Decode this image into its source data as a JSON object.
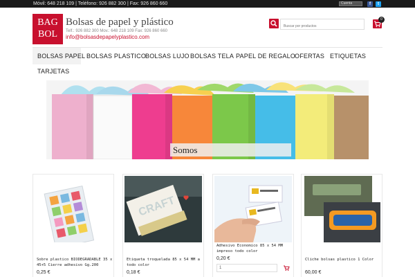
{
  "topbar": {
    "contact": "Móvil: 648 218 109 | Teléfono: 926 882 300 | Fax: 926 860 660",
    "account_label": "Cuenta",
    "facebook": "f",
    "twitter": "t"
  },
  "brand": {
    "logo_line1": "BAG",
    "logo_line2": "BOL",
    "title": "Bolsas de papel y plástico",
    "phones": "Telf.: 926 882 300   Mov.: 648 218 109   Fax: 926 860 660",
    "email": "info@bolsasdepapelyplastico.com",
    "accent": "#c8102e"
  },
  "search": {
    "placeholder": "Buscar por productos",
    "icon": "search-icon"
  },
  "cart": {
    "count": "0",
    "icon": "cart-icon"
  },
  "nav": {
    "items": [
      {
        "label": "BOLSAS PAPEL"
      },
      {
        "label": "BOLSAS PLASTICO"
      },
      {
        "label": "BOLSAS LUJO"
      },
      {
        "label": "BOLSAS TELA"
      },
      {
        "label": "PAPEL DE REGALO"
      },
      {
        "label": "OFERTAS"
      },
      {
        "label": "ETIQUETAS"
      },
      {
        "label": "TARJETAS"
      }
    ]
  },
  "banner": {
    "caption": "Somos"
  },
  "products": [
    {
      "name": "Sobre plastico BIODEGRADABLE 35 x 45+5 Cierre adhesivo Gg.200",
      "price": "0,25 €"
    },
    {
      "name": "Etiqueta troquelada 85 x 54 MM a todo color",
      "price": "0,18 €"
    },
    {
      "name": "Adhesivo Economico 85 x 54 MM impreso todo color",
      "price": "0,20 €",
      "quantity": "1"
    },
    {
      "name": "Cliche bolsas plastico 1 Color",
      "price": "60,00 €"
    }
  ]
}
